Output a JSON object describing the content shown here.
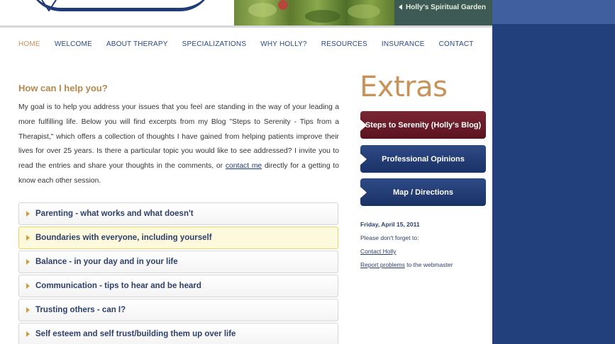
{
  "header": {
    "garden_link": "Holly's Spiritual Garden"
  },
  "nav": {
    "items": [
      {
        "label": "HOME",
        "active": true
      },
      {
        "label": "WELCOME",
        "active": false
      },
      {
        "label": "ABOUT THERAPY",
        "active": false
      },
      {
        "label": "SPECIALIZATIONS",
        "active": false
      },
      {
        "label": "WHY HOLLY?",
        "active": false
      },
      {
        "label": "RESOURCES",
        "active": false
      },
      {
        "label": "INSURANCE",
        "active": false
      },
      {
        "label": "CONTACT",
        "active": false
      }
    ]
  },
  "main": {
    "title": "How can I help you?",
    "intro_before_link": "My goal is to help you address your issues that you feel are standing in the way of your leading a more fulfilling life. Below you will find excerpts from my Blog \"Steps to Serenity - Tips from a Therapist,\" which offers a collection of thoughts I have gained from helping patients improve their lives for over 25 years. Is there a particular topic you would like to see addressed? I invite you to read the entries and share your thoughts in the comments, or ",
    "intro_link": "contact me",
    "intro_after_link": " directly for a getting to know each other session.",
    "topics": [
      "Parenting - what works and what doesn't",
      "Boundaries with everyone, including yourself",
      "Balance - in your day and in your life",
      "Communication - tips to hear and be heard",
      "Trusting others - can I?",
      "Self esteem and self trust/building them up over life"
    ]
  },
  "sidebar": {
    "title": "Extras",
    "buttons": {
      "blog": "Steps to Serenity (Holly's Blog)",
      "opinions": "Professional Opinions",
      "map": "Map / Directions"
    },
    "date": "Friday, April 15, 2011",
    "reminder": "Please don't forget to:",
    "contact_link": "Contact Holly",
    "report_link": "Report problems",
    "report_suffix": " to the webmaster"
  },
  "colors": {
    "accent_tan": "#c8935a",
    "nav_blue": "#2a4a86",
    "blog_button": "#6b1d2a",
    "nav_button": "#22407c",
    "page_bg": "#22407c"
  }
}
